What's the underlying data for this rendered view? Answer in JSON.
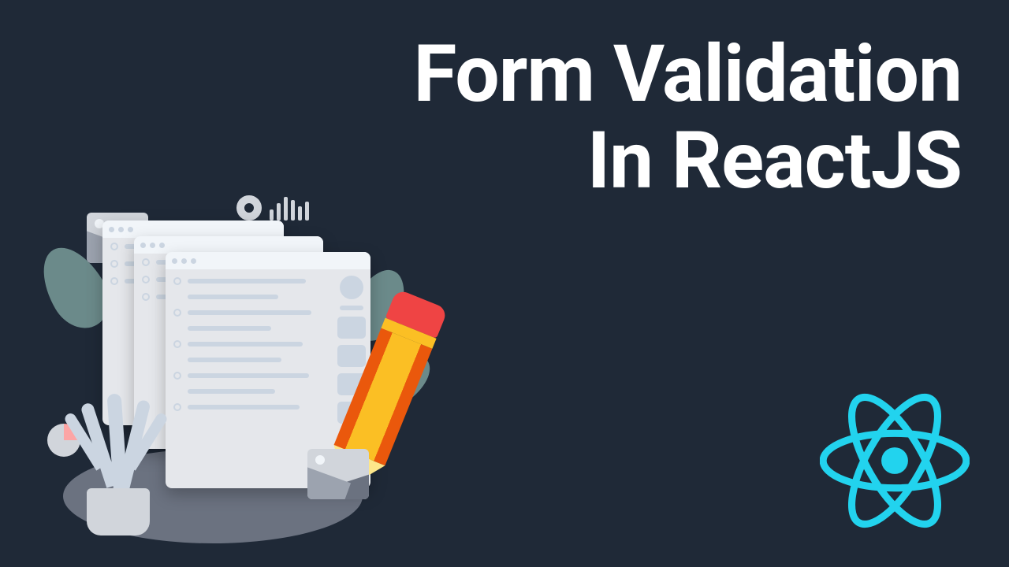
{
  "title_line1": "Form Validation",
  "title_line2": "In ReactJS",
  "colors": {
    "background": "#1f2937",
    "text": "#ffffff",
    "react_accent": "#22d3ee"
  }
}
